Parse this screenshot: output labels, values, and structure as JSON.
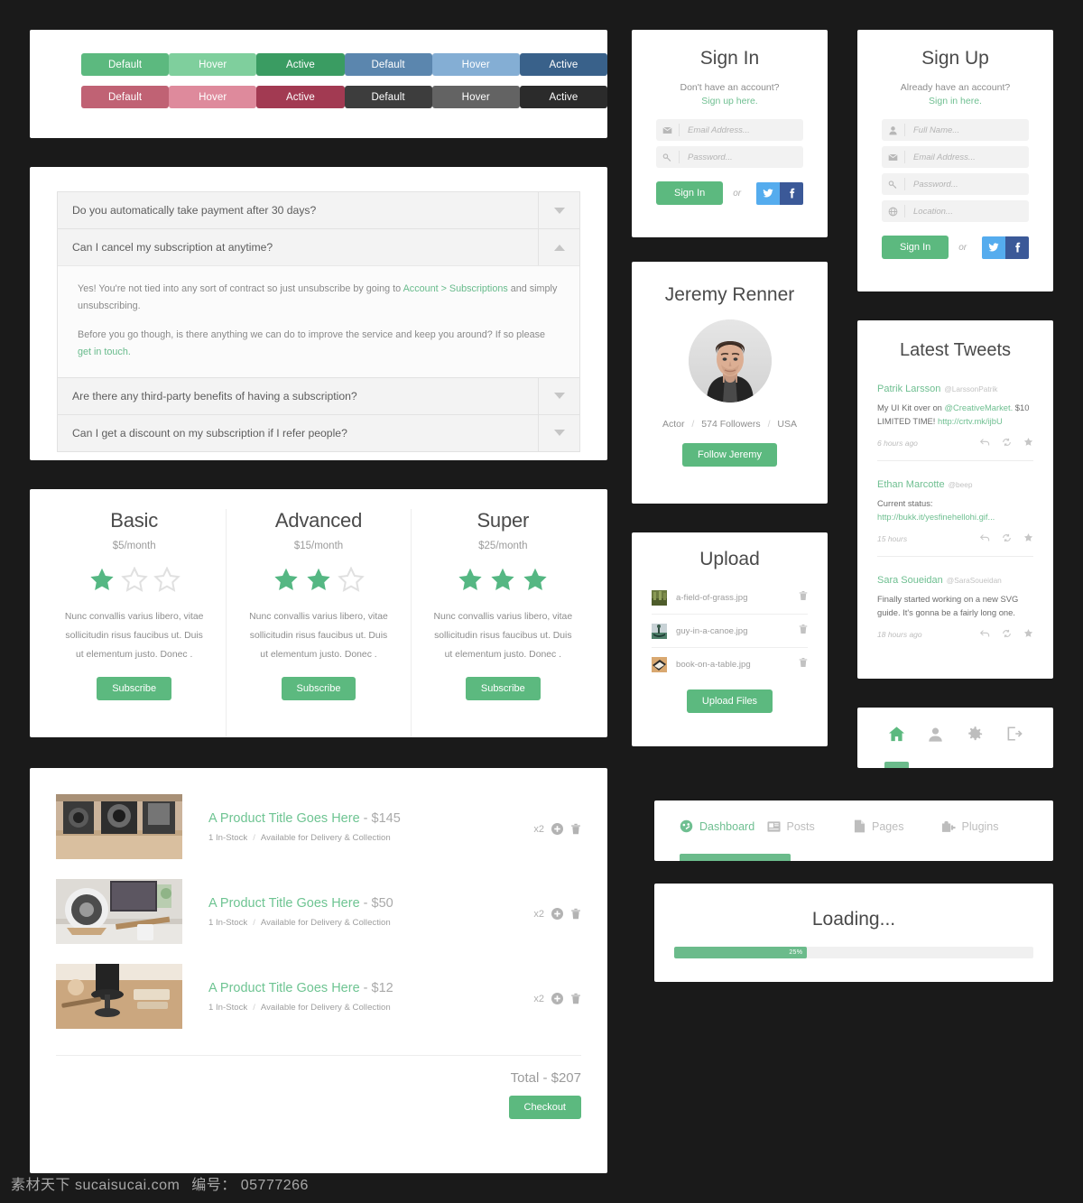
{
  "colors": {
    "green": "#5cb97f",
    "green_hover": "#7fcf9d",
    "green_active": "#3a9c62",
    "blue": "#5b86ae",
    "blue_hover": "#84aed4",
    "blue_active": "#39618a",
    "red": "#c06274",
    "red_hover": "#de8a9c",
    "red_active": "#a23a52",
    "dark": "#3d3d3d",
    "dark_hover": "#636363",
    "dark_active": "#2b2b2b",
    "accent": "#6fbf91",
    "twitter": "#55acee",
    "facebook": "#3b5998"
  },
  "buttons": {
    "rows": [
      [
        {
          "label": "Default",
          "color": "#5cb97f"
        },
        {
          "label": "Hover",
          "color": "#7fcf9d"
        },
        {
          "label": "Active",
          "color": "#3a9c62"
        },
        {
          "label": "Default",
          "color": "#5b86ae"
        },
        {
          "label": "Hover",
          "color": "#84aed4"
        },
        {
          "label": "Active",
          "color": "#39618a"
        }
      ],
      [
        {
          "label": "Default",
          "color": "#c06274"
        },
        {
          "label": "Hover",
          "color": "#de8a9c"
        },
        {
          "label": "Active",
          "color": "#a23a52"
        },
        {
          "label": "Default",
          "color": "#3d3d3d"
        },
        {
          "label": "Hover",
          "color": "#636363"
        },
        {
          "label": "Active",
          "color": "#2b2b2b"
        }
      ]
    ]
  },
  "faq": {
    "items": [
      {
        "question": "Do you automatically take payment after 30 days?",
        "expanded": false,
        "icon": "chevron-down-icon"
      },
      {
        "question": "Can I cancel my subscription at anytime?",
        "expanded": true,
        "icon": "chevron-up-icon",
        "answer_p1_a": "Yes! You're not tied into any sort of contract so just unsubscribe by going to ",
        "answer_p1_link": "Account > Subscriptions",
        "answer_p1_b": " and simply unsubscribing.",
        "answer_p2_a": "Before you go though, is there anything we can do to improve the service and keep you around? If so please ",
        "answer_p2_link": "get in touch.",
        "answer_p2_b": ""
      },
      {
        "question": "Are there any third-party benefits of having a subscription?",
        "expanded": false,
        "icon": "chevron-down-icon"
      },
      {
        "question": "Can I get a discount on my subscription if I refer people?",
        "expanded": false,
        "icon": "chevron-down-icon"
      }
    ]
  },
  "pricing": {
    "plans": [
      {
        "name": "Basic",
        "price": "$5/month",
        "stars_filled": 1,
        "stars_total": 3,
        "description": "Nunc convallis varius libero, vitae sollicitudin risus faucibus ut. Duis ut elementum justo. Donec .",
        "cta": "Subscribe"
      },
      {
        "name": "Advanced",
        "price": "$15/month",
        "stars_filled": 2,
        "stars_total": 3,
        "description": "Nunc convallis varius libero, vitae sollicitudin risus faucibus ut. Duis ut elementum justo. Donec .",
        "cta": "Subscribe"
      },
      {
        "name": "Super",
        "price": "$25/month",
        "stars_filled": 3,
        "stars_total": 3,
        "description": "Nunc convallis varius libero, vitae sollicitudin risus faucibus ut. Duis ut elementum justo. Donec .",
        "cta": "Subscribe"
      }
    ]
  },
  "cart": {
    "items": [
      {
        "title": "A Product Title Goes Here",
        "dash": " - ",
        "price": "$145",
        "stock": "1 In-Stock",
        "delivery": "Available for Delivery & Collection",
        "qty": "x2",
        "thumb_kind": "cameras-on-shelf"
      },
      {
        "title": "A Product Title Goes Here",
        "dash": " - ",
        "price": "$50",
        "stock": "1 In-Stock",
        "delivery": "Available for Delivery & Collection",
        "qty": "x2",
        "thumb_kind": "speaker-on-desk"
      },
      {
        "title": "A Product Title Goes Here",
        "dash": " - ",
        "price": "$12",
        "stock": "1 In-Stock",
        "delivery": "Available for Delivery & Collection",
        "qty": "x2",
        "thumb_kind": "desk-with-lamp"
      }
    ],
    "total_label": "Total - $207",
    "checkout_label": "Checkout"
  },
  "signin": {
    "title": "Sign In",
    "subtitle": "Don't have an account?",
    "link": "Sign up here.",
    "fields": [
      {
        "icon": "envelope-icon",
        "placeholder": "Email Address...",
        "value": ""
      },
      {
        "icon": "key-icon",
        "placeholder": "Password...",
        "value": ""
      }
    ],
    "submit": "Sign In",
    "or": "or",
    "social": [
      "twitter-icon",
      "facebook-icon"
    ]
  },
  "signup": {
    "title": "Sign Up",
    "subtitle": "Already have an account?",
    "link": "Sign in here.",
    "fields": [
      {
        "icon": "user-icon",
        "placeholder": "Full Name...",
        "value": ""
      },
      {
        "icon": "envelope-icon",
        "placeholder": "Email Address...",
        "value": ""
      },
      {
        "icon": "key-icon",
        "placeholder": "Password...",
        "value": ""
      },
      {
        "icon": "globe-icon",
        "placeholder": "Location...",
        "value": ""
      }
    ],
    "submit": "Sign In",
    "or": "or",
    "social": [
      "twitter-icon",
      "facebook-icon"
    ]
  },
  "profile": {
    "name": "Jeremy Renner",
    "avatar_alt": "portrait-photo",
    "role": "Actor",
    "followers": "574 Followers",
    "country": "USA",
    "follow_label": "Follow Jeremy"
  },
  "upload": {
    "title": "Upload",
    "files": [
      {
        "name": "a-field-of-grass.jpg",
        "thumb_kind": "grass-field"
      },
      {
        "name": "guy-in-a-canoe.jpg",
        "thumb_kind": "canoe"
      },
      {
        "name": "book-on-a-table.jpg",
        "thumb_kind": "book-table"
      }
    ],
    "button": "Upload Files"
  },
  "tweets": {
    "title": "Latest Tweets",
    "items": [
      {
        "user": "Patrik Larsson",
        "handle": "@LarssonPatrik",
        "text_a": "My UI Kit over on ",
        "text_link1": "@CreativeMarket.",
        "text_b": " $10 LIMITED TIME! ",
        "text_link2": "http://crtv.mk/ijbU",
        "text_c": "",
        "time": "6 hours ago"
      },
      {
        "user": "Ethan Marcotte",
        "handle": "@beep",
        "text_a": "Current status: ",
        "text_link1": "http://bukk.it/yesfinehellohi.gif...",
        "text_b": "",
        "text_link2": "",
        "text_c": "",
        "time": "15 hours"
      },
      {
        "user": "Sara Soueidan",
        "handle": "@SaraSoueidan",
        "text_a": "Finally started working on a new SVG guide. It's gonna be a fairly long one.",
        "text_link1": "",
        "text_b": "",
        "text_link2": "",
        "text_c": "",
        "time": "18 hours ago"
      }
    ],
    "actions": [
      "reply-icon",
      "retweet-icon",
      "favorite-icon"
    ]
  },
  "iconnav": {
    "items": [
      {
        "icon": "home-icon",
        "active": true
      },
      {
        "icon": "user-icon",
        "active": false
      },
      {
        "icon": "gear-icon",
        "active": false
      },
      {
        "icon": "logout-icon",
        "active": false
      }
    ]
  },
  "tabs": {
    "items": [
      {
        "label": "Dashboard",
        "icon": "dashboard-icon",
        "active": true
      },
      {
        "label": "Posts",
        "icon": "posts-icon",
        "active": false
      },
      {
        "label": "Pages",
        "icon": "pages-icon",
        "active": false
      },
      {
        "label": "Plugins",
        "icon": "plugins-icon",
        "active": false
      }
    ]
  },
  "loading": {
    "title": "Loading...",
    "percent_label": "25%",
    "fill_width_pct": 37
  },
  "watermark": {
    "site": "素材天下 sucaisucai.com",
    "number_label": "编号：",
    "number": "05777266"
  }
}
